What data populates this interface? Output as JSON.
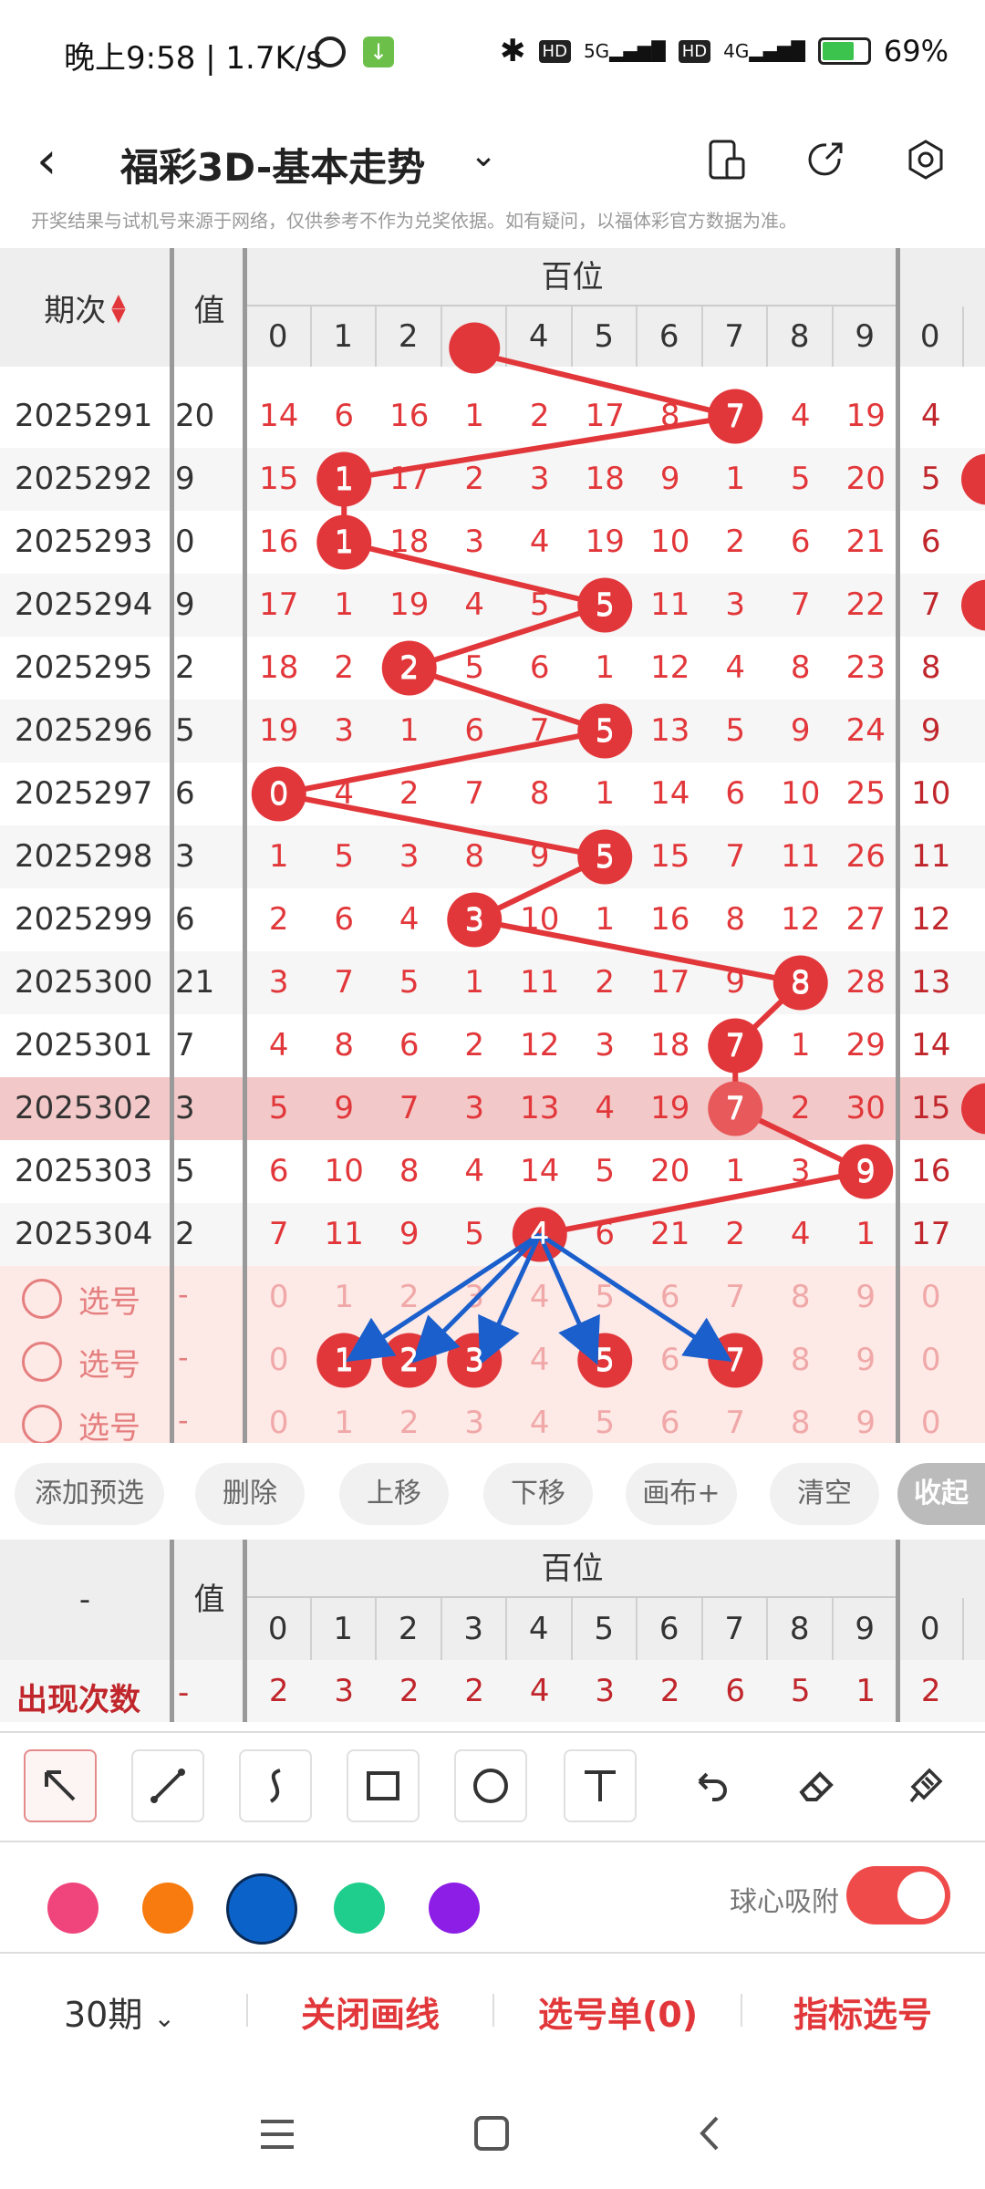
{
  "status_bar": {
    "time": "晚上9:58 | 1.7K/s",
    "battery": "69%",
    "signal_5g": "5G",
    "signal_4g": "4G",
    "hd": "HD"
  },
  "header": {
    "title": "福彩3D-基本走势"
  },
  "notice": "开奖结果与试机号来源于网络，仅供参考不作为兑奖依据。如有疑问，以福体彩官方数据为准。",
  "table": {
    "period_header": "期次",
    "value_header": "值",
    "group_header": "百位",
    "digits": [
      "0",
      "1",
      "2",
      "3",
      "4",
      "5",
      "6",
      "7",
      "8",
      "9",
      "0"
    ],
    "rows": [
      {
        "period": "2025291",
        "value": "20",
        "cells": [
          "14",
          "6",
          "16",
          "1",
          "2",
          "17",
          "8",
          "7",
          "4",
          "19",
          "4"
        ],
        "hit": 7
      },
      {
        "period": "2025292",
        "value": "9",
        "cells": [
          "15",
          "1",
          "17",
          "2",
          "3",
          "18",
          "9",
          "1",
          "5",
          "20",
          "5"
        ],
        "hit": 1
      },
      {
        "period": "2025293",
        "value": "0",
        "cells": [
          "16",
          "1",
          "18",
          "3",
          "4",
          "19",
          "10",
          "2",
          "6",
          "21",
          "6"
        ],
        "hit": 1
      },
      {
        "period": "2025294",
        "value": "9",
        "cells": [
          "17",
          "1",
          "19",
          "4",
          "5",
          "5",
          "11",
          "3",
          "7",
          "22",
          "7"
        ],
        "hit": 5
      },
      {
        "period": "2025295",
        "value": "2",
        "cells": [
          "18",
          "2",
          "2",
          "5",
          "6",
          "1",
          "12",
          "4",
          "8",
          "23",
          "8"
        ],
        "hit": 2
      },
      {
        "period": "2025296",
        "value": "5",
        "cells": [
          "19",
          "3",
          "1",
          "6",
          "7",
          "5",
          "13",
          "5",
          "9",
          "24",
          "9"
        ],
        "hit": 5
      },
      {
        "period": "2025297",
        "value": "6",
        "cells": [
          "0",
          "4",
          "2",
          "7",
          "8",
          "1",
          "14",
          "6",
          "10",
          "25",
          "10"
        ],
        "hit": 0
      },
      {
        "period": "2025298",
        "value": "3",
        "cells": [
          "1",
          "5",
          "3",
          "8",
          "9",
          "5",
          "15",
          "7",
          "11",
          "26",
          "11"
        ],
        "hit": 5
      },
      {
        "period": "2025299",
        "value": "6",
        "cells": [
          "2",
          "6",
          "4",
          "3",
          "10",
          "1",
          "16",
          "8",
          "12",
          "27",
          "12"
        ],
        "hit": 3
      },
      {
        "period": "2025300",
        "value": "21",
        "cells": [
          "3",
          "7",
          "5",
          "1",
          "11",
          "2",
          "17",
          "9",
          "8",
          "28",
          "13"
        ],
        "hit": 8
      },
      {
        "period": "2025301",
        "value": "7",
        "cells": [
          "4",
          "8",
          "6",
          "2",
          "12",
          "3",
          "18",
          "7",
          "1",
          "29",
          "14"
        ],
        "hit": 7
      },
      {
        "period": "2025302",
        "value": "3",
        "cells": [
          "5",
          "9",
          "7",
          "3",
          "13",
          "4",
          "19",
          "7",
          "2",
          "30",
          "15"
        ],
        "hit": 7,
        "highlight": true
      },
      {
        "period": "2025303",
        "value": "5",
        "cells": [
          "6",
          "10",
          "8",
          "4",
          "14",
          "5",
          "20",
          "1",
          "3",
          "9",
          "16"
        ],
        "hit": 9
      },
      {
        "period": "2025304",
        "value": "2",
        "cells": [
          "7",
          "11",
          "9",
          "5",
          "4",
          "6",
          "21",
          "2",
          "4",
          "1",
          "17"
        ],
        "hit": 4
      }
    ],
    "select_rows": [
      {
        "label": "选号",
        "dash": "-",
        "cells": [
          "0",
          "1",
          "2",
          "3",
          "4",
          "5",
          "6",
          "7",
          "8",
          "9",
          "0"
        ],
        "hits": []
      },
      {
        "label": "选号",
        "dash": "-",
        "cells": [
          "0",
          "1",
          "2",
          "3",
          "4",
          "5",
          "6",
          "7",
          "8",
          "9",
          "0"
        ],
        "hits": [
          1,
          2,
          3,
          5,
          7
        ]
      },
      {
        "label": "选号",
        "dash": "-",
        "cells": [
          "0",
          "1",
          "2",
          "3",
          "4",
          "5",
          "6",
          "7",
          "8",
          "9",
          "0"
        ],
        "hits": []
      }
    ]
  },
  "actions": [
    "添加预选",
    "删除",
    "上移",
    "下移",
    "画布+",
    "清空",
    "收起"
  ],
  "stats": {
    "left_header": "-",
    "value_header": "值",
    "group_header": "百位",
    "digits": [
      "0",
      "1",
      "2",
      "3",
      "4",
      "5",
      "6",
      "7",
      "8",
      "9",
      "0"
    ],
    "row_label": "出现次数",
    "row_value": "-",
    "counts": [
      "2",
      "3",
      "2",
      "2",
      "4",
      "3",
      "2",
      "6",
      "5",
      "1",
      "2"
    ]
  },
  "tools": [
    "arrow-tool",
    "line-tool",
    "curve-tool",
    "rectangle-tool",
    "circle-tool",
    "text-tool",
    "undo-tool",
    "eraser-tool",
    "clear-tool"
  ],
  "colors": [
    "#f0457c",
    "#f77b0e",
    "#0b62c8",
    "#1fce8c",
    "#8c1ee6"
  ],
  "snap_label": "球心吸附",
  "bottom": {
    "period": "30期",
    "close_lines": "关闭画线",
    "selection": "选号单(0)",
    "indicator": "指标选号"
  },
  "colors_theme": {
    "red": "#e2373a",
    "blue": "#1a5fcc"
  }
}
